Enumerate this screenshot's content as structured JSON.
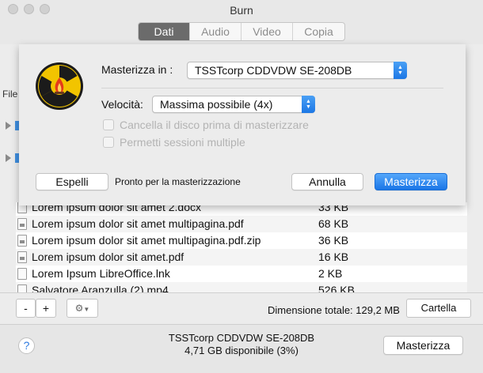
{
  "window": {
    "title": "Burn"
  },
  "tabs": [
    {
      "label": "Dati",
      "active": true
    },
    {
      "label": "Audio",
      "active": false
    },
    {
      "label": "Video",
      "active": false
    },
    {
      "label": "Copia",
      "active": false
    }
  ],
  "sidebar_strip": {
    "text": "File"
  },
  "dialog": {
    "burn_in_label": "Masterizza in :",
    "drive_value": "TSSTcorp CDDVDW SE-208DB",
    "speed_label": "Velocità:",
    "speed_value": "Massima possibile (4x)",
    "erase_label": "Cancella il disco prima di masterizzare",
    "multisession_label": "Permetti sessioni multiple",
    "eject_button": "Espelli",
    "status_text": "Pronto per la masterizzazione",
    "cancel_button": "Annulla",
    "burn_button": "Masterizza"
  },
  "files": [
    {
      "name": "Lorem ipsum dolor sit amet 2.docx",
      "size": "33 KB"
    },
    {
      "name": "Lorem ipsum dolor sit amet multipagina.pdf",
      "size": "68 KB"
    },
    {
      "name": "Lorem ipsum dolor sit amet multipagina.pdf.zip",
      "size": "36 KB"
    },
    {
      "name": "Lorem ipsum dolor sit amet.pdf",
      "size": "16 KB"
    },
    {
      "name": "Lorem Ipsum LibreOffice.lnk",
      "size": "2 KB"
    },
    {
      "name": "Salvatore Aranzulla (2).mp4",
      "size": "526 KB"
    }
  ],
  "bottom_bar": {
    "remove_label": "-",
    "add_label": "+",
    "total_label": "Dimensione totale: 129,2 MB",
    "folder_button": "Cartella"
  },
  "footer": {
    "help_label": "?",
    "device_name": "TSSTcorp CDDVDW SE-208DB",
    "available": "4,71 GB disponibile (3%)",
    "burn_button": "Masterizza"
  },
  "colors": {
    "accent": "#1a75e6",
    "tab_active": "#6b6b6b"
  }
}
